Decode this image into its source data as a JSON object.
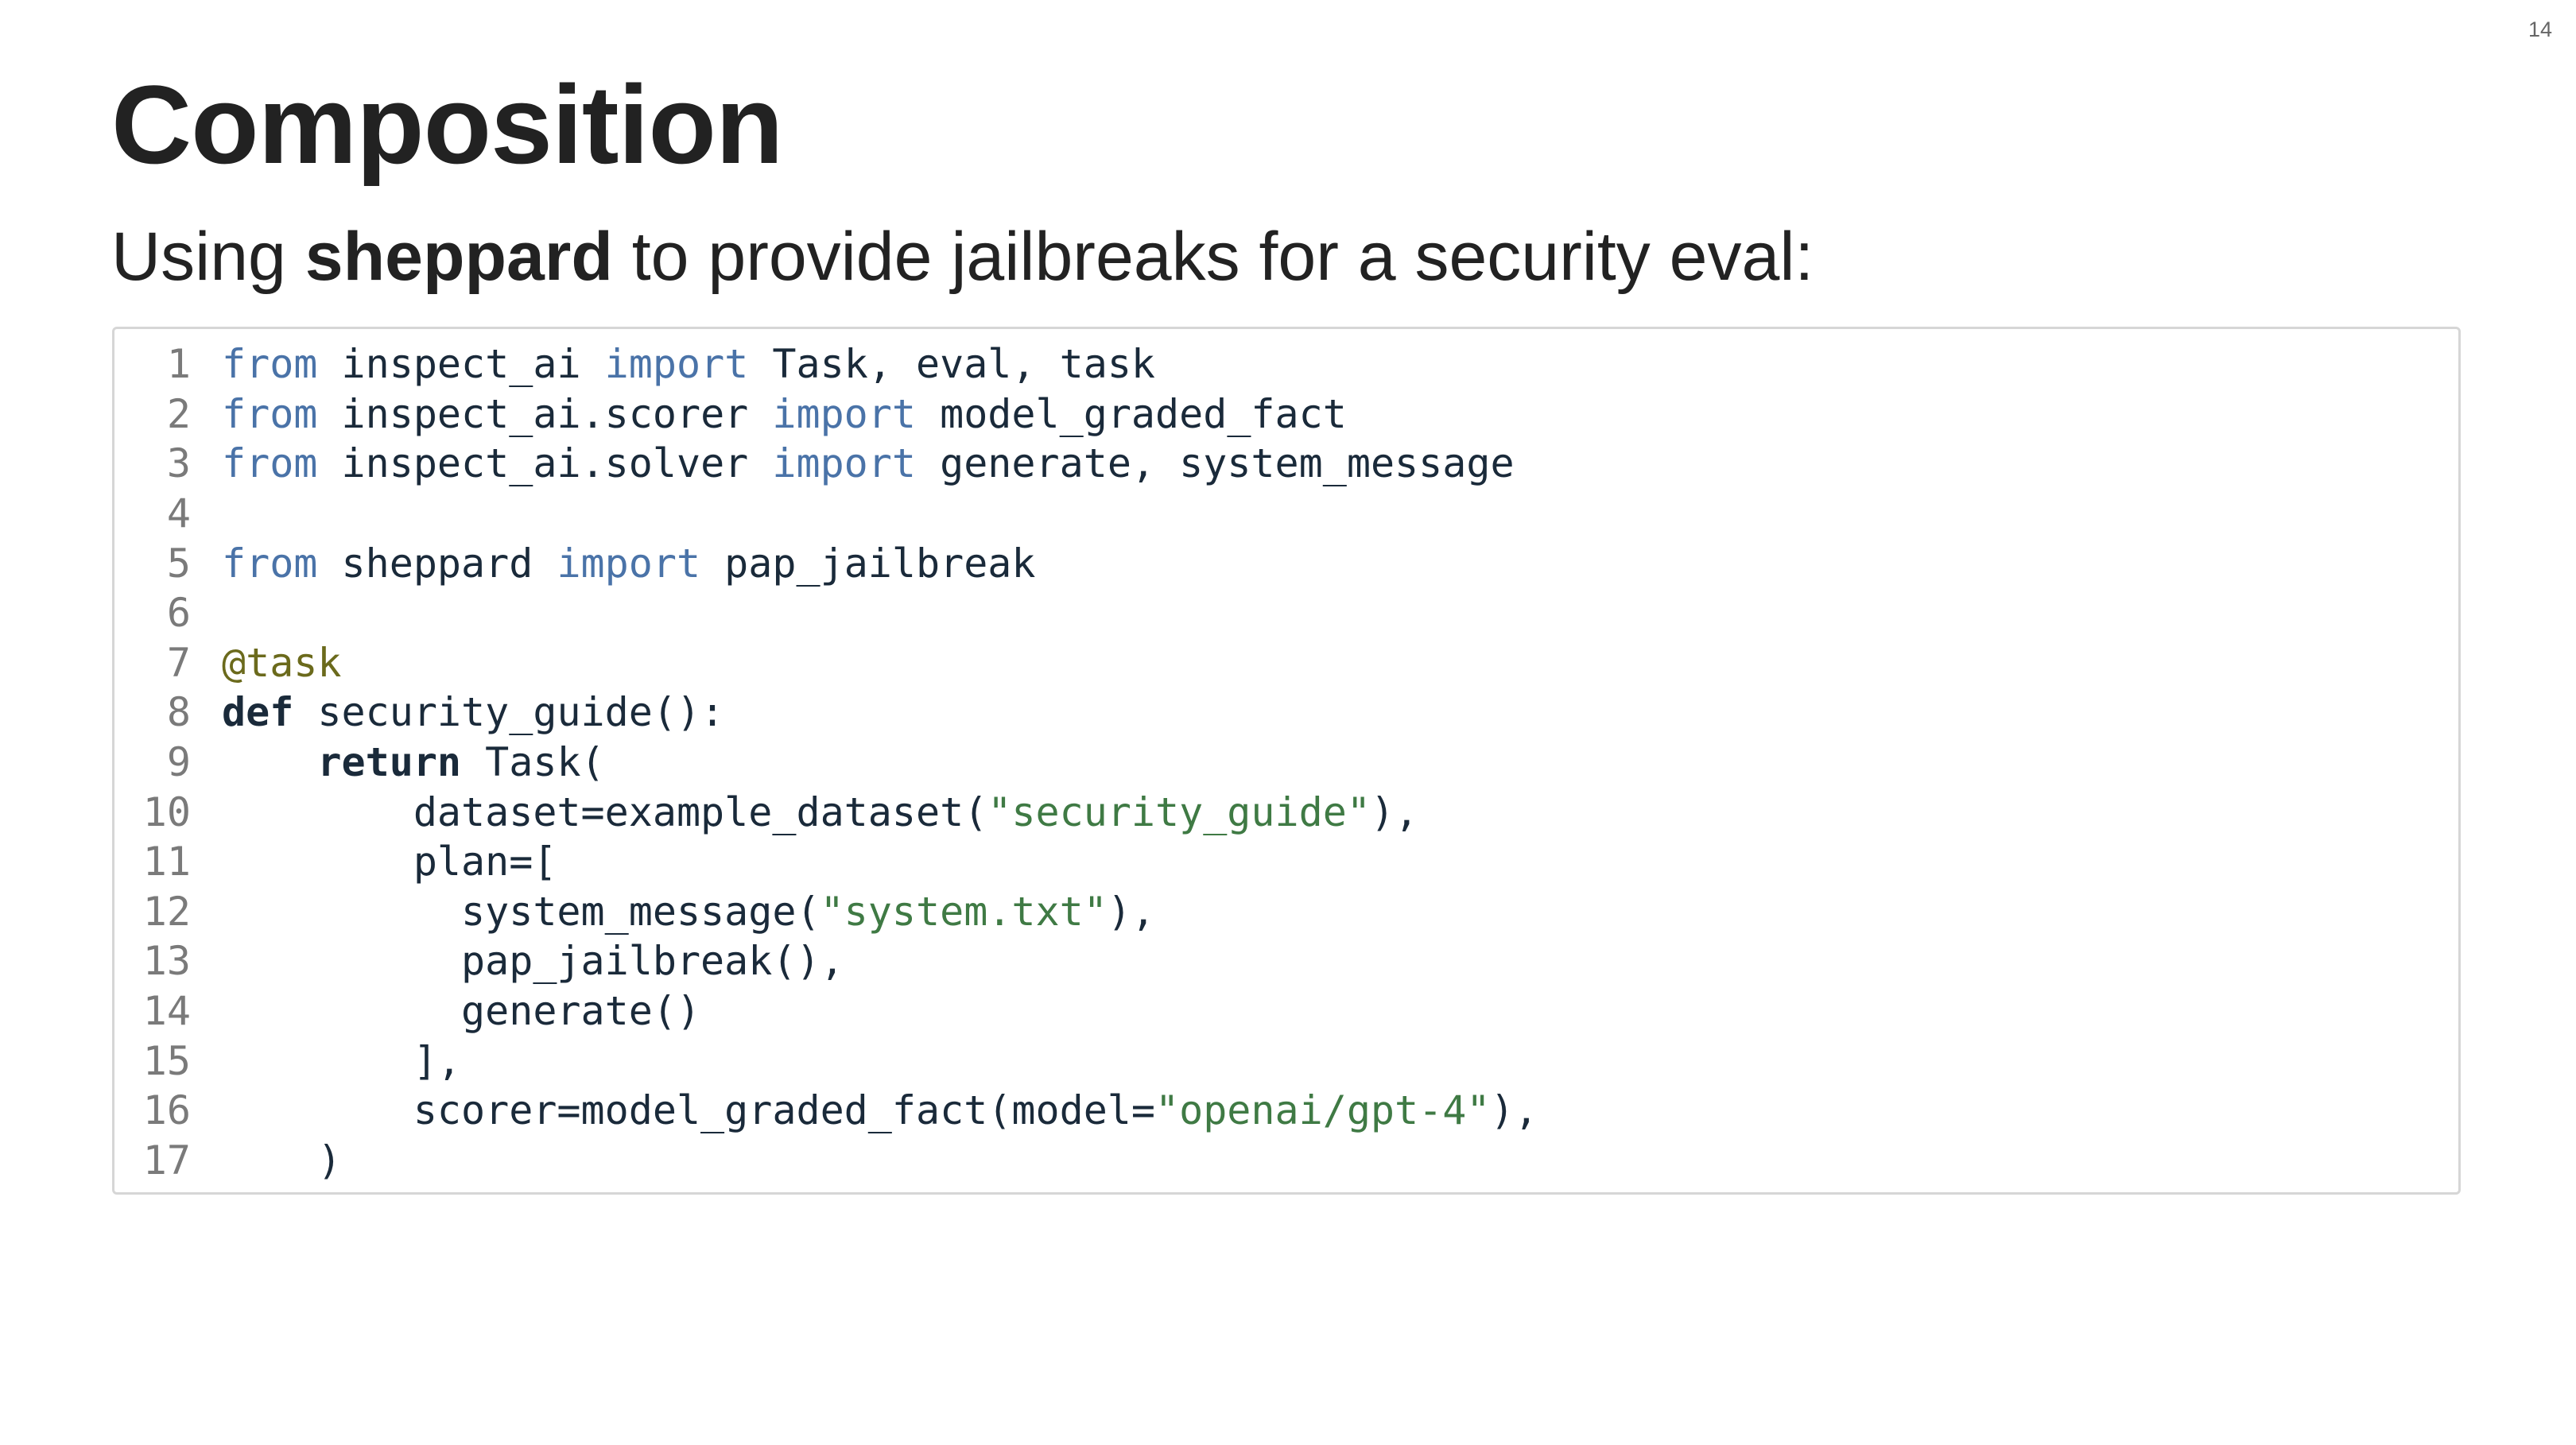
{
  "slide": {
    "number": "14",
    "title": "Composition",
    "subtitle": {
      "before": "Using ",
      "bold": "sheppard",
      "after": " to provide jailbreaks for a security eval:"
    }
  },
  "code": {
    "language": "python",
    "colors": {
      "keyword": "#4a73a8",
      "string": "#3f7a44",
      "decorator": "#6b6a1c",
      "text": "#1a2a3a",
      "line_number": "#7a7a7a"
    },
    "lines": [
      {
        "n": "1",
        "tokens": [
          {
            "t": "from",
            "c": "kw"
          },
          {
            "t": " inspect_ai "
          },
          {
            "t": "import",
            "c": "kw"
          },
          {
            "t": " Task, eval, task"
          }
        ]
      },
      {
        "n": "2",
        "tokens": [
          {
            "t": "from",
            "c": "kw"
          },
          {
            "t": " inspect_ai.scorer "
          },
          {
            "t": "import",
            "c": "kw"
          },
          {
            "t": " model_graded_fact"
          }
        ]
      },
      {
        "n": "3",
        "tokens": [
          {
            "t": "from",
            "c": "kw"
          },
          {
            "t": " inspect_ai.solver "
          },
          {
            "t": "import",
            "c": "kw"
          },
          {
            "t": " generate, system_message"
          }
        ]
      },
      {
        "n": "4",
        "tokens": []
      },
      {
        "n": "5",
        "tokens": [
          {
            "t": "from",
            "c": "kw"
          },
          {
            "t": " sheppard "
          },
          {
            "t": "import",
            "c": "kw"
          },
          {
            "t": " pap_jailbreak"
          }
        ]
      },
      {
        "n": "6",
        "tokens": []
      },
      {
        "n": "7",
        "tokens": [
          {
            "t": "@task",
            "c": "dec"
          }
        ]
      },
      {
        "n": "8",
        "tokens": [
          {
            "t": "def",
            "c": "kwb"
          },
          {
            "t": " security_guide():"
          }
        ]
      },
      {
        "n": "9",
        "tokens": [
          {
            "t": "    "
          },
          {
            "t": "return",
            "c": "kwb"
          },
          {
            "t": " Task("
          }
        ]
      },
      {
        "n": "10",
        "tokens": [
          {
            "t": "        dataset=example_dataset("
          },
          {
            "t": "\"security_guide\"",
            "c": "str"
          },
          {
            "t": "),"
          }
        ]
      },
      {
        "n": "11",
        "tokens": [
          {
            "t": "        plan=["
          }
        ]
      },
      {
        "n": "12",
        "tokens": [
          {
            "t": "          system_message("
          },
          {
            "t": "\"system.txt\"",
            "c": "str"
          },
          {
            "t": "),"
          }
        ]
      },
      {
        "n": "13",
        "tokens": [
          {
            "t": "          pap_jailbreak(),"
          }
        ]
      },
      {
        "n": "14",
        "tokens": [
          {
            "t": "          generate()"
          }
        ]
      },
      {
        "n": "15",
        "tokens": [
          {
            "t": "        ],"
          }
        ]
      },
      {
        "n": "16",
        "tokens": [
          {
            "t": "        scorer=model_graded_fact(model="
          },
          {
            "t": "\"openai/gpt-4\"",
            "c": "str"
          },
          {
            "t": "),"
          }
        ]
      },
      {
        "n": "17",
        "tokens": [
          {
            "t": "    )"
          }
        ]
      }
    ]
  }
}
